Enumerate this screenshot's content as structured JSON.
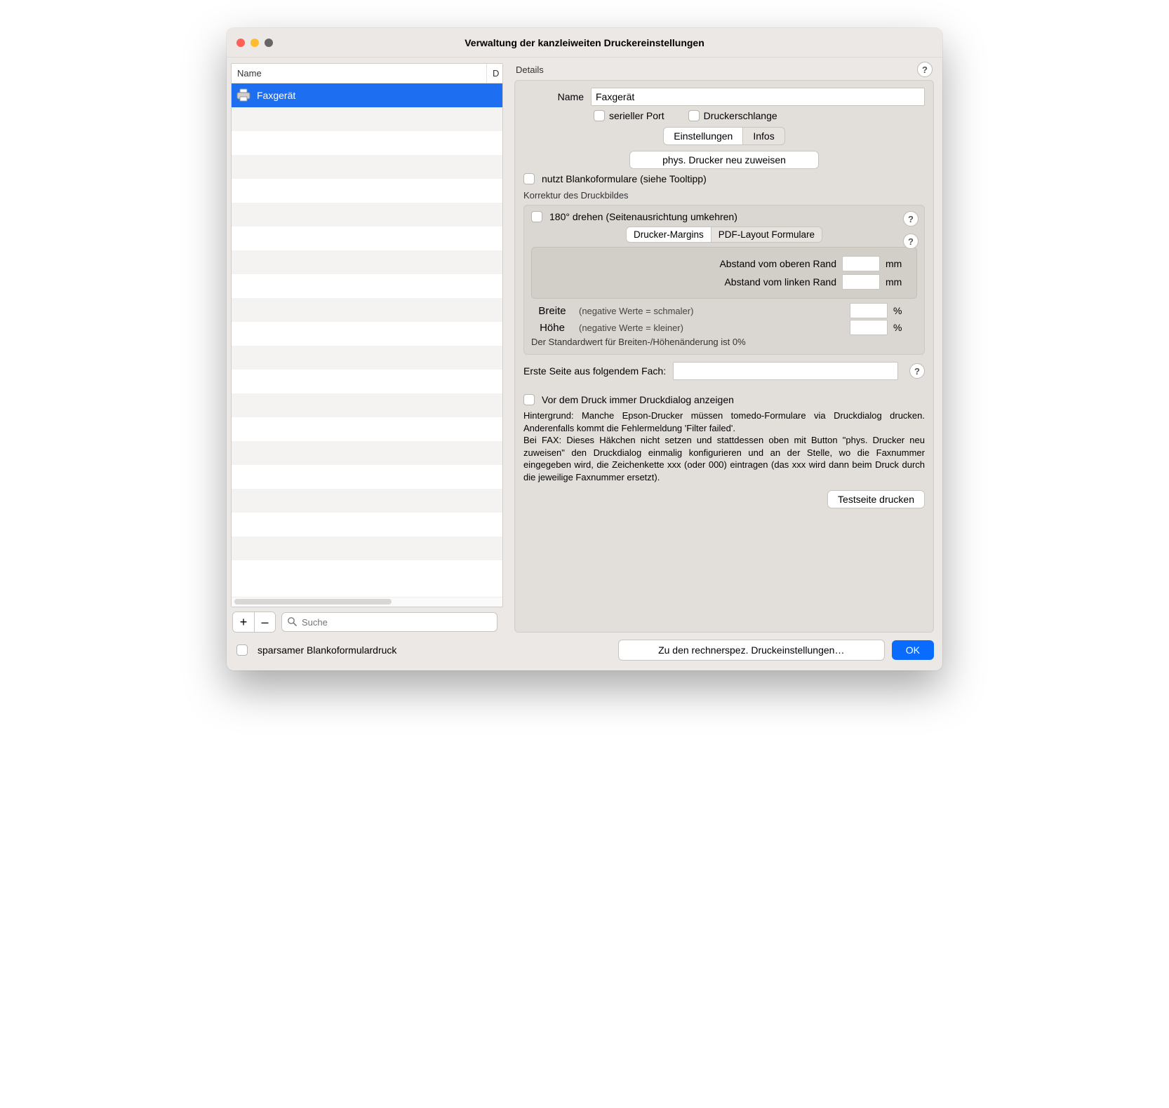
{
  "window": {
    "title": "Verwaltung der kanzleiweiten Druckereinstellungen"
  },
  "list": {
    "col_name": "Name",
    "col_d": "D",
    "items": [
      {
        "name": "Faxgerät",
        "selected": true
      }
    ],
    "add_label": "+",
    "remove_label": "–",
    "search_placeholder": "Suche"
  },
  "details": {
    "heading": "Details",
    "name_label": "Name",
    "name_value": "Faxgerät",
    "serial_port_label": "serieller Port",
    "print_queue_label": "Druckerschlange",
    "tab_settings": "Einstellungen",
    "tab_infos": "Infos",
    "reassign_button": "phys. Drucker neu zuweisen",
    "blank_forms_label": "nutzt Blankoformulare (siehe Tooltipp)",
    "correction_heading": "Korrektur des Druckbildes",
    "rotate_label": "180° drehen (Seitenausrichtung umkehren)",
    "inner_tab_margins": "Drucker-Margins",
    "inner_tab_pdf": "PDF-Layout Formulare",
    "margin_top_label": "Abstand vom oberen Rand",
    "margin_left_label": "Abstand vom linken Rand",
    "margin_top_value": "",
    "margin_left_value": "",
    "unit_mm": "mm",
    "width_label": "Breite",
    "height_label": "Höhe",
    "width_hint": "(negative Werte = schmaler)",
    "height_hint": "(negative Werte = kleiner)",
    "width_value": "",
    "height_value": "",
    "unit_percent": "%",
    "default_note": "Der Standardwert für Breiten-/Höhenänderung ist 0%",
    "tray_label": "Erste Seite aus folgendem Fach:",
    "tray_value": "",
    "show_dialog_label": "Vor dem Druck immer Druckdialog anzeigen",
    "background_text": "Hintergrund: Manche Epson-Drucker müssen tomedo-Formulare via Druckdialog drucken. Anderenfalls kommt die Fehlermeldung 'Filter failed'.\nBei FAX: Dieses Häkchen nicht setzen und stattdessen oben mit Button \"phys. Drucker neu zuweisen\" den Druckdialog einmalig konfigurieren und an der Stelle, wo die Faxnummer eingegeben wird, die Zeichenkette xxx (oder 000) eintragen (das xxx wird dann beim Druck durch die jeweilige Faxnummer ersetzt).",
    "testpage_button": "Testseite drucken"
  },
  "footer": {
    "sparing_label": "sparsamer Blankoformulardruck",
    "computer_settings_button": "Zu den rechnerspez. Druckeinstellungen…",
    "ok_button": "OK"
  },
  "icons": {
    "help": "?"
  }
}
